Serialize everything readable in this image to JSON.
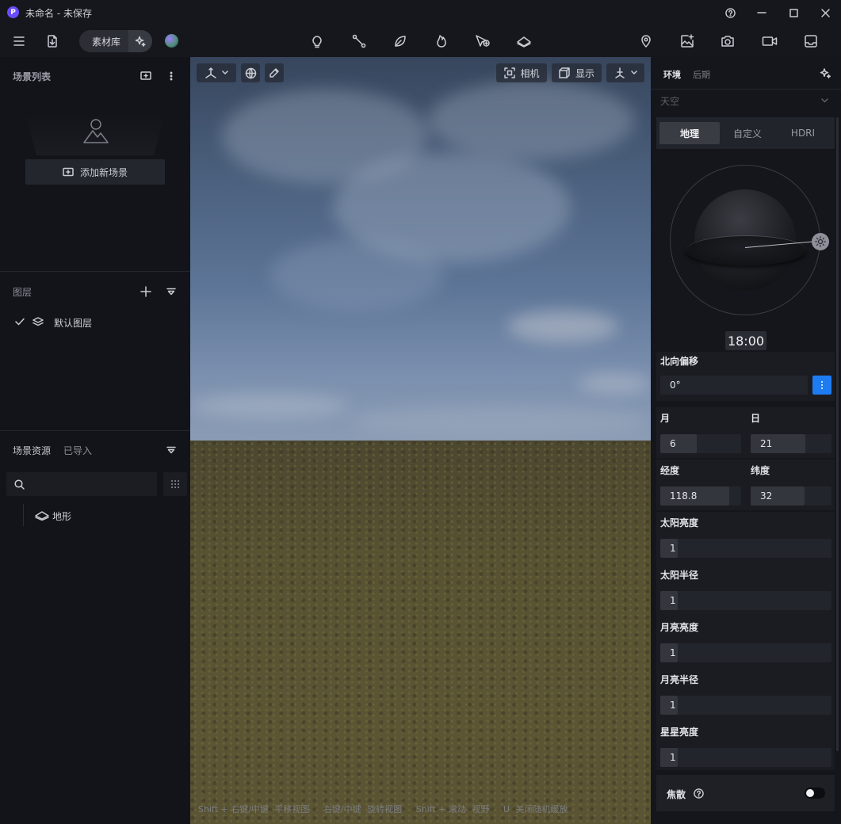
{
  "window": {
    "title": "未命名 - 未保存"
  },
  "topbar": {
    "library_label": "素材库"
  },
  "left": {
    "scene_list_title": "场景列表",
    "add_scene_label": "添加新场景",
    "layers_title": "图层",
    "layer_items": [
      {
        "label": "默认图层"
      }
    ],
    "assets_title": "场景资源",
    "assets_tab_imported": "已导入",
    "asset_items": [
      {
        "label": "地形"
      }
    ]
  },
  "viewport": {
    "camera_label": "相机",
    "display_label": "显示",
    "hints": [
      "Shift + 右键/中键",
      "平移视图",
      "右键/中键",
      "旋转视图",
      "Shift + 滚动",
      "视野",
      "U",
      "关闭随机缓放"
    ]
  },
  "right": {
    "tabs": [
      "环境",
      "后期"
    ],
    "sky_section": "天空",
    "sky_modes": [
      "地理",
      "自定义",
      "HDRI"
    ],
    "time": "18:00",
    "north_offset_label": "北向偏移",
    "north_offset_value": "0°",
    "month_label": "月",
    "month_value": "6",
    "month_fill": 0.45,
    "day_label": "日",
    "day_value": "21",
    "day_fill": 0.68,
    "longitude_label": "经度",
    "longitude_value": "118.8",
    "longitude_fill": 0.85,
    "latitude_label": "纬度",
    "latitude_value": "32",
    "latitude_fill": 0.67,
    "sun_brightness_label": "太阳亮度",
    "sun_brightness_value": "1",
    "sun_radius_label": "太阳半径",
    "sun_radius_value": "1",
    "moon_brightness_label": "月亮亮度",
    "moon_brightness_value": "1",
    "moon_radius_label": "月亮半径",
    "moon_radius_value": "1",
    "star_brightness_label": "星星亮度",
    "star_brightness_value": "1",
    "defocus_label": "焦散",
    "defocus_on": false
  },
  "icons": [
    "app-logo-icon",
    "help-icon",
    "minimize-icon",
    "maximize-icon",
    "close-icon",
    "menu-icon",
    "import-file-icon",
    "sparkle-icon",
    "material-ball-icon",
    "light-icon",
    "path-icon",
    "leaf-icon",
    "fire-icon",
    "cursor-plus-icon",
    "terrain-icon",
    "location-icon",
    "image-plus-icon",
    "camera-icon",
    "video-icon",
    "export-icon"
  ],
  "colors": {
    "accent": "#1e7cf2",
    "brand": "#6a4cff"
  }
}
